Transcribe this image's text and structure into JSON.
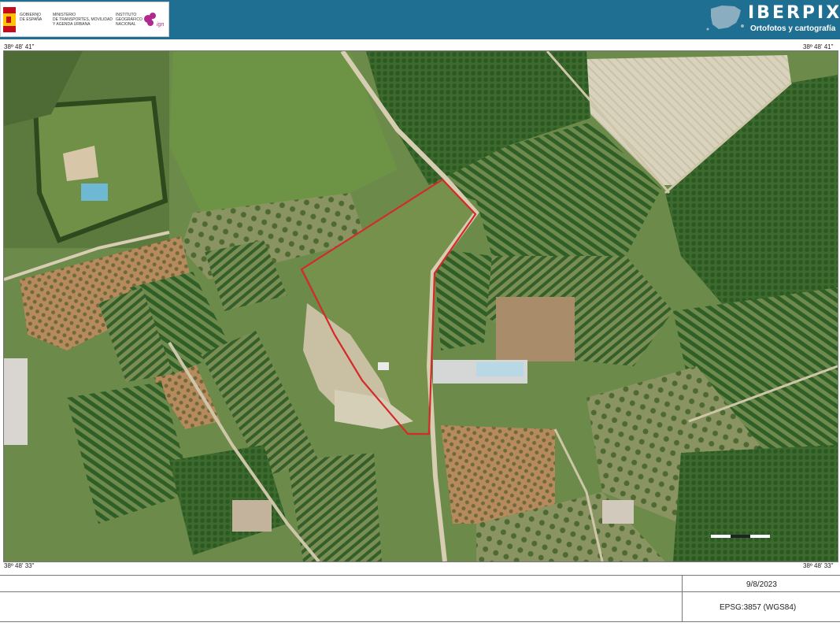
{
  "header": {
    "gov_lines_1": [
      "GOBIERNO",
      "DE ESPAÑA"
    ],
    "gov_lines_2": [
      "MINISTERIO",
      "DE TRANSPORTES, MOVILIDAD",
      "Y AGENDA URBANA"
    ],
    "gov_lines_3": [
      "INSTITUTO",
      "GEOGRÁFICO",
      "NACIONAL"
    ],
    "ign_mark": "ign",
    "app_title": "IBERPIX",
    "app_subtitle": "Ortofotos y cartografía"
  },
  "coordinates": {
    "top_left": "38º 48' 41\"",
    "top_right": "38º 48' 41\"",
    "bottom_left": "38º 48' 33\"",
    "bottom_right": "38º 48' 33\""
  },
  "map": {
    "type": "aerial-orthophoto",
    "parcel_outline_color": "#d42a2a",
    "background_color": "#5e7d44"
  },
  "footer": {
    "date": "9/8/2023",
    "projection": "EPSG:3857 (WGS84)"
  }
}
